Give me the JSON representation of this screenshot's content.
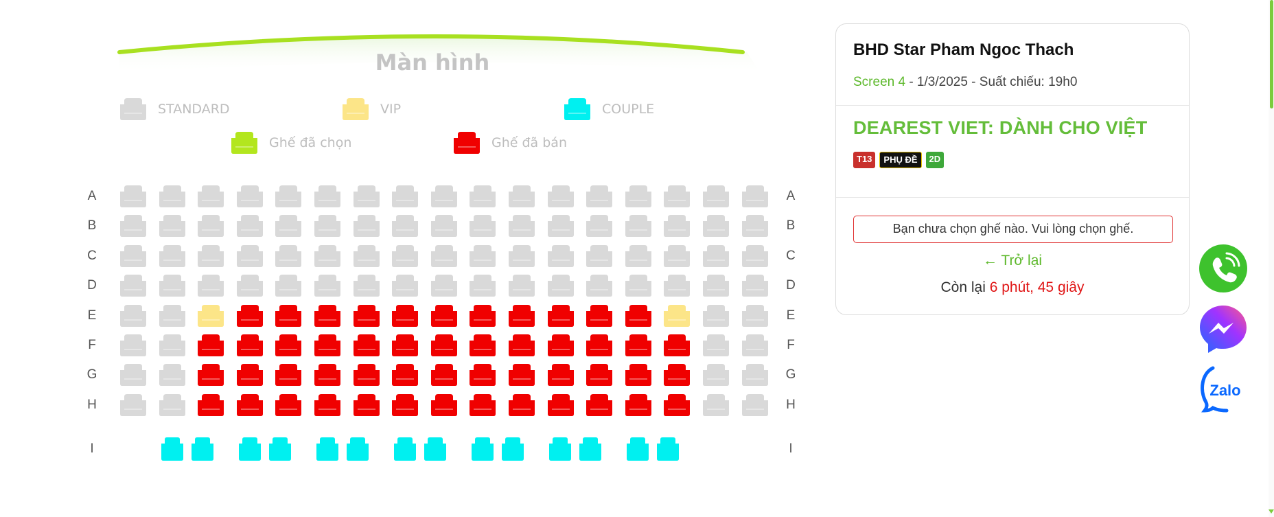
{
  "screen": {
    "label": "Màn hình"
  },
  "legend": {
    "standard": "STANDARD",
    "vip": "VIP",
    "couple": "COUPLE",
    "selected": "Ghế đã chọn",
    "sold": "Ghế đã bán"
  },
  "colors": {
    "standard": "#d9d9d9",
    "vip": "#fce588",
    "couple": "#00f0f0",
    "selected": "#b3e61e",
    "sold": "#f00000",
    "accent": "#64bd3a"
  },
  "rows": [
    "A",
    "B",
    "C",
    "D",
    "E",
    "F",
    "G",
    "H"
  ],
  "seat_map": {
    "A": "SSSSSSSSSSSSSSSSS",
    "B": "SSSSSSSSSSSSSSSSS",
    "C": "SSSSSSSSSSSSSSSSS",
    "D": "SSSSSSSSSSSSSSSSS",
    "E": "SSVXXXXXXXXXXXVSS",
    "F": "SSXXXXXXXXXXXXXSS",
    "G": "SSXXXXXXXXXXXXXSS",
    "H": "SSXXXXXXXXXXXXXSS"
  },
  "couple_row": {
    "label": "I",
    "count": 7
  },
  "booking": {
    "cinema": "BHD Star Pham Ngoc Thach",
    "screen": "Screen 4",
    "details": " - 1/3/2025 - Suất chiếu: 19h0",
    "movie": "DEAREST VIET: DÀNH CHO VIỆT",
    "badges": {
      "age": "T13",
      "subtitle": "PHỤ ĐỀ",
      "format": "2D"
    },
    "warning": "Bạn chưa chọn ghế nào. Vui lòng chọn ghế.",
    "back": "← Trở lại",
    "timer_prefix": "Còn lại ",
    "timer_value": "6 phút, 45 giây"
  },
  "contact": {
    "phone": "phone-icon",
    "messenger": "messenger-icon",
    "zalo": "Zalo"
  }
}
